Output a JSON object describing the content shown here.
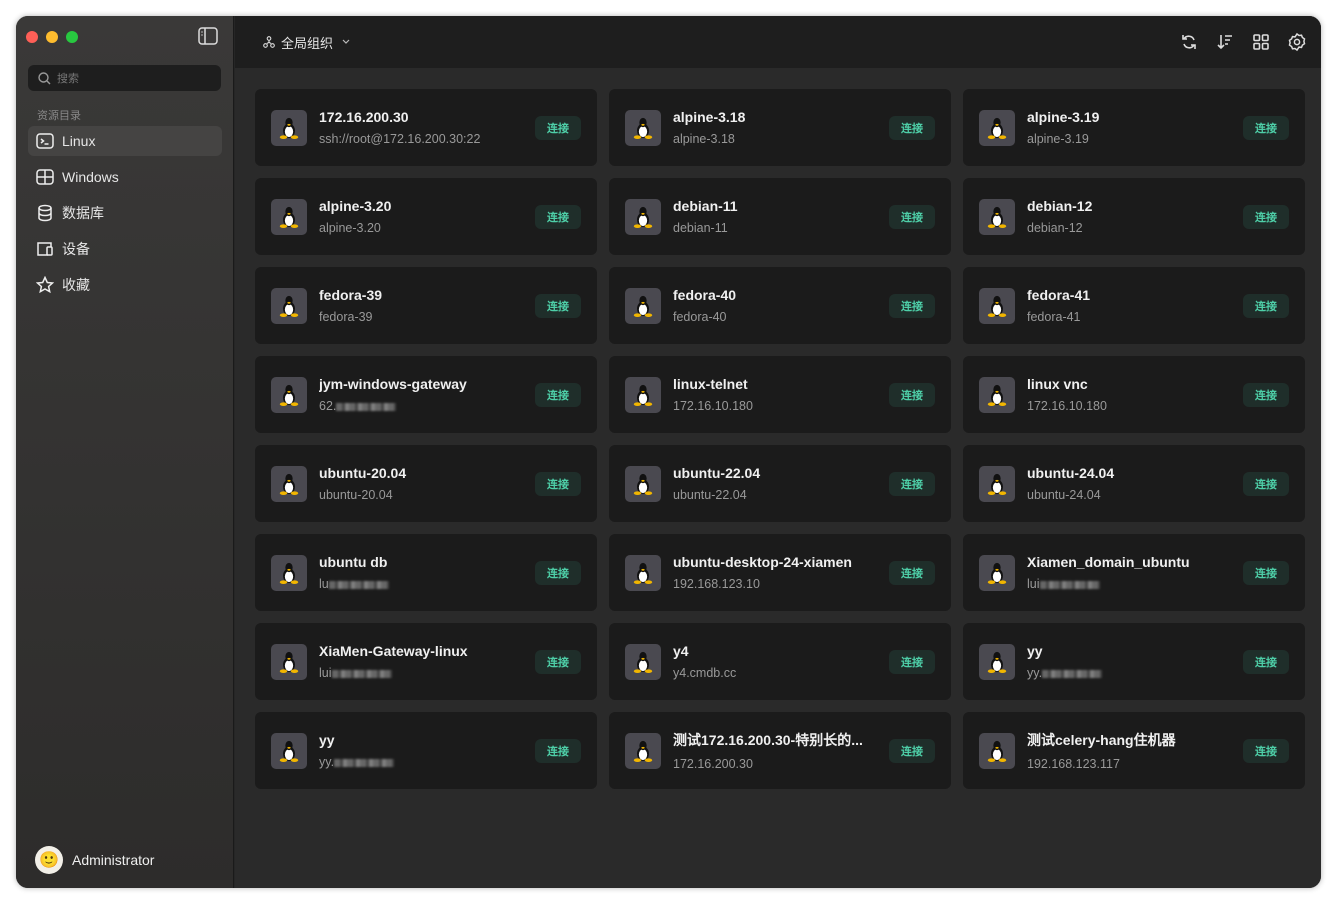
{
  "sidebar": {
    "search_placeholder": "搜索",
    "section": "资源目录",
    "items": [
      {
        "label": "Linux",
        "icon": "terminal-icon"
      },
      {
        "label": "Windows",
        "icon": "windows-icon"
      },
      {
        "label": "数据库",
        "icon": "database-icon"
      },
      {
        "label": "设备",
        "icon": "device-icon"
      },
      {
        "label": "收藏",
        "icon": "star-icon"
      }
    ],
    "user": "Administrator"
  },
  "header": {
    "org": "全局组织",
    "tools": [
      "refresh-icon",
      "sort-icon",
      "grid-icon",
      "settings-icon"
    ]
  },
  "connect_label": "连接",
  "colors": {
    "accent": "#4ecfa8",
    "card": "#1b1b1b"
  },
  "assets": [
    {
      "name": "172.16.200.30",
      "sub": "ssh://root@172.16.200.30:22"
    },
    {
      "name": "alpine-3.18",
      "sub": "alpine-3.18"
    },
    {
      "name": "alpine-3.19",
      "sub": "alpine-3.19"
    },
    {
      "name": "alpine-3.20",
      "sub": "alpine-3.20"
    },
    {
      "name": "debian-11",
      "sub": "debian-11"
    },
    {
      "name": "debian-12",
      "sub": "debian-12"
    },
    {
      "name": "fedora-39",
      "sub": "fedora-39"
    },
    {
      "name": "fedora-40",
      "sub": "fedora-40"
    },
    {
      "name": "fedora-41",
      "sub": "fedora-41"
    },
    {
      "name": "jym-windows-gateway",
      "sub": "62.",
      "blurred": true
    },
    {
      "name": "linux-telnet",
      "sub": "172.16.10.180"
    },
    {
      "name": "linux vnc",
      "sub": "172.16.10.180"
    },
    {
      "name": "ubuntu-20.04",
      "sub": "ubuntu-20.04"
    },
    {
      "name": "ubuntu-22.04",
      "sub": "ubuntu-22.04"
    },
    {
      "name": "ubuntu-24.04",
      "sub": "ubuntu-24.04"
    },
    {
      "name": "ubuntu db",
      "sub": "lu",
      "blurred": true
    },
    {
      "name": "ubuntu-desktop-24-xiamen",
      "sub": "192.168.123.10"
    },
    {
      "name": "Xiamen_domain_ubuntu",
      "sub": "lui",
      "blurred": true
    },
    {
      "name": "XiaMen-Gateway-linux",
      "sub": "lui",
      "blurred": true
    },
    {
      "name": "y4",
      "sub": "y4.cmdb.cc"
    },
    {
      "name": "yy",
      "sub": "yy.",
      "blurred": true
    },
    {
      "name": "yy",
      "sub": "yy.",
      "blurred": true
    },
    {
      "name": "测试172.16.200.30-特别长的...",
      "sub": "172.16.200.30"
    },
    {
      "name": "测试celery-hang住机器",
      "sub": "192.168.123.117"
    }
  ]
}
